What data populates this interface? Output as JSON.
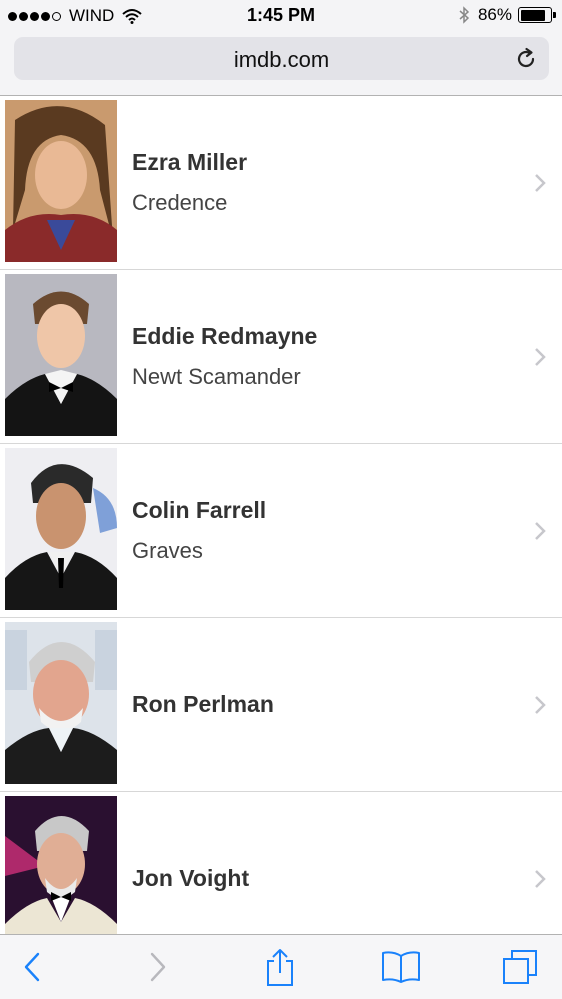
{
  "status_bar": {
    "carrier": "WIND",
    "time": "1:45 PM",
    "battery_percent": "86%",
    "battery_level": 0.86,
    "signal_dots_filled": 4,
    "icons": [
      "wifi-icon",
      "bluetooth-icon",
      "battery-icon"
    ]
  },
  "address_bar": {
    "url": "imdb.com",
    "reload_icon": "reload-icon"
  },
  "cast": [
    {
      "name": "Ezra Miller",
      "character": "Credence"
    },
    {
      "name": "Eddie Redmayne",
      "character": "Newt Scamander"
    },
    {
      "name": "Colin Farrell",
      "character": "Graves"
    },
    {
      "name": "Ron Perlman",
      "character": ""
    },
    {
      "name": "Jon Voight",
      "character": ""
    }
  ],
  "toolbar": {
    "buttons": [
      "back-icon",
      "forward-icon",
      "share-icon",
      "bookmarks-icon",
      "tabs-icon"
    ]
  },
  "colors": {
    "accent": "#1a82fb",
    "disabled": "#b8b8bd",
    "chevron": "#c7c7cc"
  }
}
